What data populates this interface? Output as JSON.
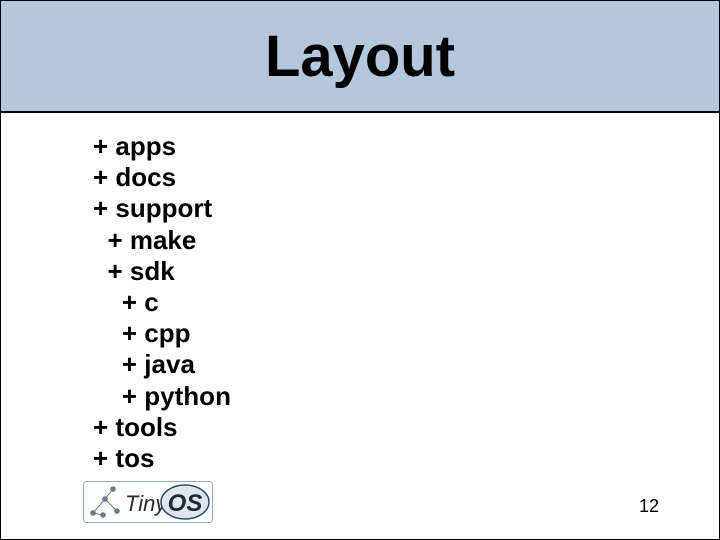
{
  "title": "Layout",
  "tree": [
    {
      "indent": 0,
      "label": "apps"
    },
    {
      "indent": 0,
      "label": "docs"
    },
    {
      "indent": 0,
      "label": "support"
    },
    {
      "indent": 1,
      "label": "make"
    },
    {
      "indent": 1,
      "label": "sdk"
    },
    {
      "indent": 2,
      "label": "c"
    },
    {
      "indent": 2,
      "label": "cpp"
    },
    {
      "indent": 2,
      "label": "java"
    },
    {
      "indent": 2,
      "label": "python"
    },
    {
      "indent": 0,
      "label": "tools"
    },
    {
      "indent": 0,
      "label": "tos"
    }
  ],
  "page_number": "12",
  "logo": {
    "text_tiny": "Tiny",
    "text_os": "OS"
  }
}
